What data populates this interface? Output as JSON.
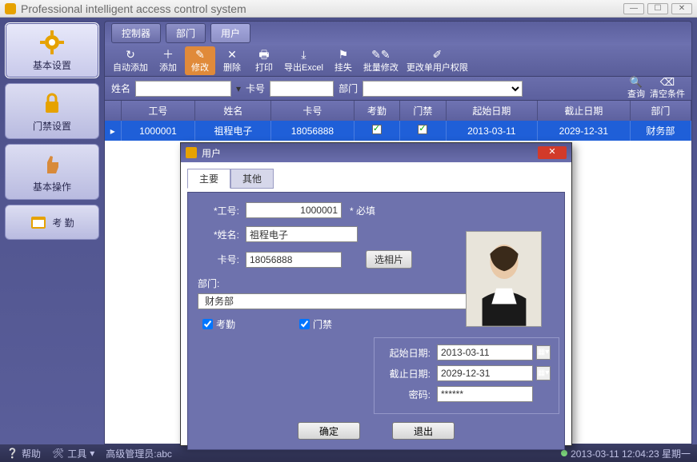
{
  "window": {
    "title": "Professional intelligent access control system"
  },
  "leftnav": [
    {
      "label": "基本设置"
    },
    {
      "label": "门禁设置"
    },
    {
      "label": "基本操作"
    },
    {
      "label": "考 勤"
    }
  ],
  "tabs": {
    "controller": "控制器",
    "department": "部门",
    "user": "用户"
  },
  "toolbar": {
    "auto_add": "自动添加",
    "add": "添加",
    "edit": "修改",
    "delete": "删除",
    "print": "打印",
    "export": "导出Excel",
    "loss": "挂失",
    "batch_edit": "批量修改",
    "change_perm": "更改单用户权限"
  },
  "search": {
    "name_label": "姓名",
    "card_label": "卡号",
    "dept_label": "部门",
    "name_value": "",
    "card_value": "",
    "query": "查询",
    "clear": "清空条件"
  },
  "table": {
    "headers": {
      "id": "工号",
      "name": "姓名",
      "card": "卡号",
      "att": "考勤",
      "acc": "门禁",
      "start": "起始日期",
      "end": "截止日期",
      "dept": "部门"
    },
    "rows": [
      {
        "id": "1000001",
        "name": "祖程电子",
        "card": "18056888",
        "att": true,
        "acc": true,
        "start": "2013-03-11",
        "end": "2029-12-31",
        "dept": "财务部"
      }
    ]
  },
  "dialog": {
    "title": "用户",
    "tab_main": "主要",
    "tab_other": "其他",
    "id_label": "*工号:",
    "id_value": "1000001",
    "required_hint": "* 必填",
    "name_label": "*姓名:",
    "name_value": "祖程电子",
    "card_label": "卡号:",
    "card_value": "18056888",
    "photo_btn": "选相片",
    "dept_label": "部门:",
    "dept_value": "财务部",
    "att_check": "考勤",
    "acc_check": "门禁",
    "start_label": "起始日期:",
    "start_value": "2013-03-11",
    "end_label": "截止日期:",
    "end_value": "2029-12-31",
    "pwd_label": "密码:",
    "pwd_value": "******",
    "ok": "确定",
    "cancel": "退出"
  },
  "status": {
    "help": "帮助",
    "tools": "工具",
    "admin": "高级管理员:abc",
    "datetime": "2013-03-11 12:04:23 星期一"
  }
}
